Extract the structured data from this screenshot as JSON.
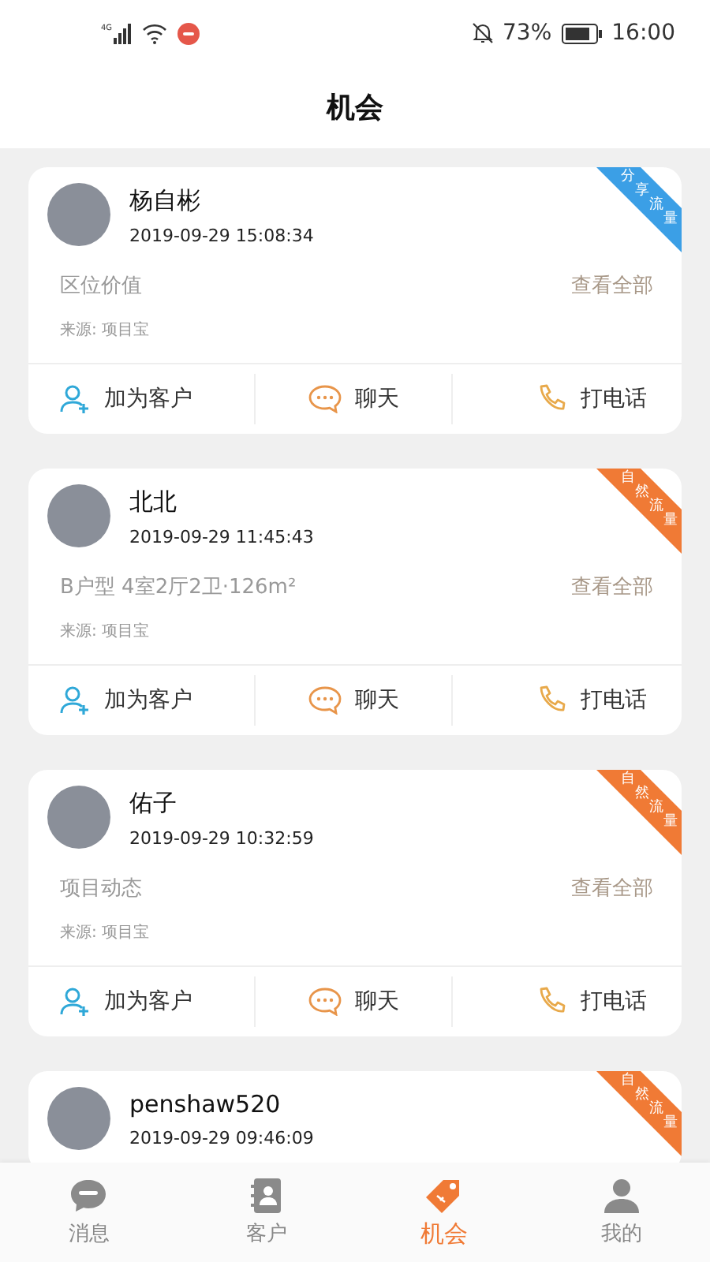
{
  "status_bar": {
    "network": "4G",
    "battery": "73%",
    "time": "16:00"
  },
  "header": {
    "title": "机会"
  },
  "cards": [
    {
      "name": "杨自彬",
      "time": "2019-09-29 15:08:34",
      "tag": "分享流量",
      "color": "#3b9fe6",
      "subject": "区位价值",
      "view_all": "查看全部",
      "source": "来源: 项目宝",
      "actions": [
        "加为客户",
        "聊天",
        "打电话"
      ]
    },
    {
      "name": "北北",
      "time": "2019-09-29 11:45:43",
      "tag": "自然流量",
      "color": "#f07a35",
      "subject": "B户型 4室2厅2卫·126m²",
      "view_all": "查看全部",
      "source": "来源: 项目宝",
      "actions": [
        "加为客户",
        "聊天",
        "打电话"
      ]
    },
    {
      "name": "佑子",
      "time": "2019-09-29 10:32:59",
      "tag": "自然流量",
      "color": "#f07a35",
      "subject": "项目动态",
      "view_all": "查看全部",
      "source": "来源: 项目宝",
      "actions": [
        "加为客户",
        "聊天",
        "打电话"
      ]
    },
    {
      "name": "penshaw520",
      "time": "2019-09-29 09:46:09",
      "tag": "自然流量",
      "color": "#f07a35"
    }
  ],
  "tabs": [
    {
      "label": "消息",
      "selected": false
    },
    {
      "label": "客户",
      "selected": false
    },
    {
      "label": "机会",
      "selected": true
    },
    {
      "label": "我的",
      "selected": false
    }
  ]
}
